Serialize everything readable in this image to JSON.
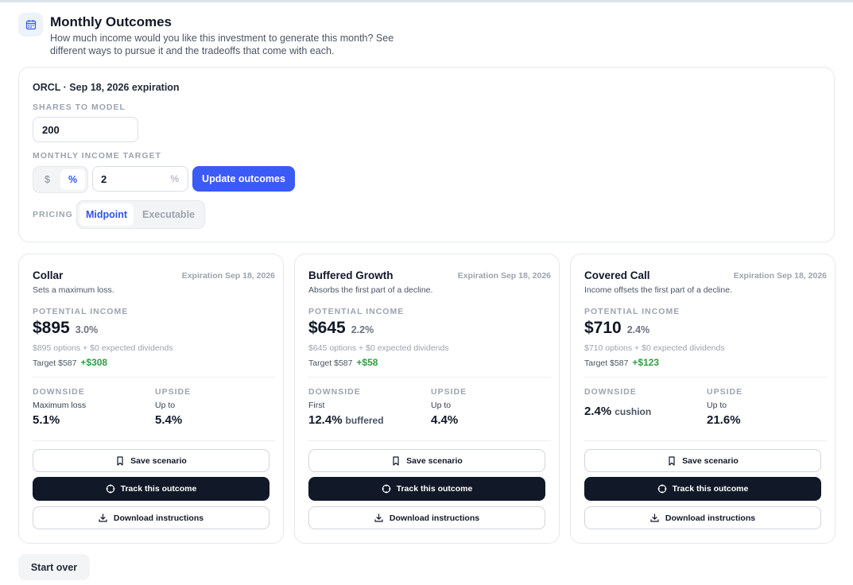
{
  "header": {
    "icon": "calendar-icon",
    "title": "Monthly Outcomes",
    "description": "How much income would you like this investment to generate this month? See different ways to pursue it and the tradeoffs that come with each."
  },
  "config": {
    "title": "ORCL · Sep 18, 2026 expiration",
    "shares_label": "SHARES TO MODEL",
    "shares_value": "200",
    "target_label": "MONTHLY INCOME TARGET",
    "unit_options": [
      "$",
      "%"
    ],
    "unit_selected": "%",
    "target_value": "2",
    "target_suffix": "%",
    "update_label": "Update outcomes",
    "pricing_label": "PRICING",
    "pricing_options": [
      "Midpoint",
      "Executable"
    ],
    "pricing_selected": "Midpoint"
  },
  "cards": [
    {
      "title": "Collar",
      "expiration": "Expiration Sep 18, 2026",
      "subtitle": "Sets a maximum loss.",
      "income_label": "POTENTIAL INCOME",
      "income": "$895",
      "income_pct": "3.0%",
      "breakdown": "$895 options + $0 expected dividends",
      "target": "Target $587",
      "target_delta": "+$308",
      "downside_label": "DOWNSIDE",
      "downside_sub": "Maximum loss",
      "downside_value": "5.1%",
      "downside_note": "",
      "upside_label": "UPSIDE",
      "upside_sub": "Up to",
      "upside_value": "5.4%"
    },
    {
      "title": "Buffered Growth",
      "expiration": "Expiration Sep 18, 2026",
      "subtitle": "Absorbs the first part of a decline.",
      "income_label": "POTENTIAL INCOME",
      "income": "$645",
      "income_pct": "2.2%",
      "breakdown": "$645 options + $0 expected dividends",
      "target": "Target $587",
      "target_delta": "+$58",
      "downside_label": "DOWNSIDE",
      "downside_sub": "First",
      "downside_value": "12.4%",
      "downside_note": "buffered",
      "upside_label": "UPSIDE",
      "upside_sub": "Up to",
      "upside_value": "4.4%"
    },
    {
      "title": "Covered Call",
      "expiration": "Expiration Sep 18, 2026",
      "subtitle": "Income offsets the first part of a decline.",
      "income_label": "POTENTIAL INCOME",
      "income": "$710",
      "income_pct": "2.4%",
      "breakdown": "$710 options + $0 expected dividends",
      "target": "Target $587",
      "target_delta": "+$123",
      "downside_label": "DOWNSIDE",
      "downside_sub": "",
      "downside_value": "2.4%",
      "downside_note": "cushion",
      "upside_label": "UPSIDE",
      "upside_sub": "Up to",
      "upside_value": "21.6%"
    }
  ],
  "actions": {
    "save_label": "Save scenario",
    "save_icon": "bookmark-icon",
    "track_label": "Track this outcome",
    "track_icon": "target-icon",
    "download_label": "Download instructions",
    "download_icon": "download-icon"
  },
  "start_over_label": "Start over",
  "colors": {
    "accent": "#3b5bf6",
    "dark": "#111827",
    "positive": "#2f9e44"
  }
}
